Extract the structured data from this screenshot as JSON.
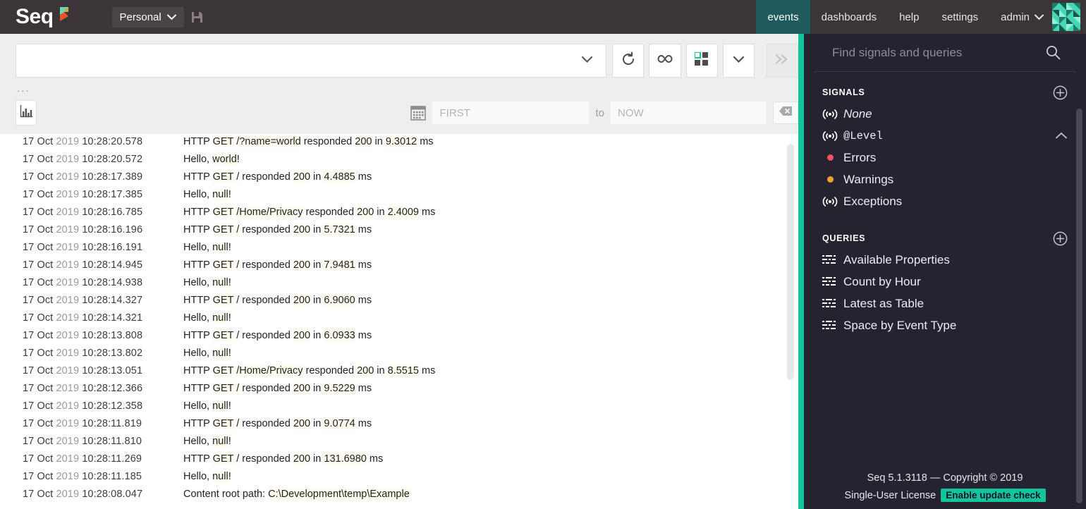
{
  "navbar": {
    "brand": "Seq",
    "brand_mark_icon": "seq-flag-logo",
    "personal_label": "Personal",
    "personal_chevron_icon": "chevron-down-icon",
    "save_icon": "save-disk-icon",
    "items": [
      {
        "label": "events",
        "active": true
      },
      {
        "label": "dashboards",
        "active": false
      },
      {
        "label": "help",
        "active": false
      },
      {
        "label": "settings",
        "active": false
      }
    ],
    "admin_label": "admin",
    "admin_chevron_icon": "chevron-down-icon",
    "avatar_icon": "user-identicon-avatar"
  },
  "toolbar": {
    "query_value": "",
    "query_placeholder": "",
    "query_chevron_icon": "chevron-down-icon",
    "refresh_icon": "refresh-icon",
    "tail_icon": "infinity-tail-icon",
    "grid_icon": "grid-columns-icon",
    "more_chevron_icon": "chevron-down-icon",
    "expand_icon": "double-chevron-right-icon",
    "ellipsis": "...",
    "chart_toggle_icon": "bar-chart-icon",
    "calendar_icon": "calendar-icon",
    "range_from_value": "",
    "range_from_placeholder": "FIRST",
    "range_to_label": "to",
    "range_to_value": "",
    "range_to_placeholder": "NOW",
    "clear_icon": "clear-backspace-icon"
  },
  "events": [
    {
      "date": "17 Oct ",
      "year": "2019",
      "time": "10:28:20.578",
      "parts": [
        {
          "t": "HTTP ",
          "h": false
        },
        {
          "t": "GET",
          "h": true
        },
        {
          "t": " ",
          "h": false
        },
        {
          "t": "/?name=world",
          "h": true
        },
        {
          "t": " responded ",
          "h": false
        },
        {
          "t": "200",
          "h": true
        },
        {
          "t": " in ",
          "h": false
        },
        {
          "t": "9.3012",
          "h": true
        },
        {
          "t": " ms",
          "h": false
        }
      ]
    },
    {
      "date": "17 Oct ",
      "year": "2019",
      "time": "10:28:20.572",
      "parts": [
        {
          "t": "Hello, ",
          "h": false
        },
        {
          "t": "world",
          "h": true
        },
        {
          "t": "!",
          "h": false
        }
      ]
    },
    {
      "date": "17 Oct ",
      "year": "2019",
      "time": "10:28:17.389",
      "parts": [
        {
          "t": "HTTP ",
          "h": false
        },
        {
          "t": "GET",
          "h": true
        },
        {
          "t": " ",
          "h": false
        },
        {
          "t": "/",
          "h": true
        },
        {
          "t": " responded ",
          "h": false
        },
        {
          "t": "200",
          "h": true
        },
        {
          "t": " in ",
          "h": false
        },
        {
          "t": "4.4885",
          "h": true
        },
        {
          "t": " ms",
          "h": false
        }
      ]
    },
    {
      "date": "17 Oct ",
      "year": "2019",
      "time": "10:28:17.385",
      "parts": [
        {
          "t": "Hello, ",
          "h": false
        },
        {
          "t": "null",
          "h": true
        },
        {
          "t": "!",
          "h": false
        }
      ]
    },
    {
      "date": "17 Oct ",
      "year": "2019",
      "time": "10:28:16.785",
      "parts": [
        {
          "t": "HTTP ",
          "h": false
        },
        {
          "t": "GET",
          "h": true
        },
        {
          "t": " ",
          "h": false
        },
        {
          "t": "/Home/Privacy",
          "h": true
        },
        {
          "t": " responded ",
          "h": false
        },
        {
          "t": "200",
          "h": true
        },
        {
          "t": " in ",
          "h": false
        },
        {
          "t": "2.4009",
          "h": true
        },
        {
          "t": " ms",
          "h": false
        }
      ]
    },
    {
      "date": "17 Oct ",
      "year": "2019",
      "time": "10:28:16.196",
      "parts": [
        {
          "t": "HTTP ",
          "h": false
        },
        {
          "t": "GET",
          "h": true
        },
        {
          "t": " ",
          "h": false
        },
        {
          "t": "/",
          "h": true
        },
        {
          "t": " responded ",
          "h": false
        },
        {
          "t": "200",
          "h": true
        },
        {
          "t": " in ",
          "h": false
        },
        {
          "t": "5.7321",
          "h": true
        },
        {
          "t": " ms",
          "h": false
        }
      ]
    },
    {
      "date": "17 Oct ",
      "year": "2019",
      "time": "10:28:16.191",
      "parts": [
        {
          "t": "Hello, ",
          "h": false
        },
        {
          "t": "null",
          "h": true
        },
        {
          "t": "!",
          "h": false
        }
      ]
    },
    {
      "date": "17 Oct ",
      "year": "2019",
      "time": "10:28:14.945",
      "parts": [
        {
          "t": "HTTP ",
          "h": false
        },
        {
          "t": "GET",
          "h": true
        },
        {
          "t": " ",
          "h": false
        },
        {
          "t": "/",
          "h": true
        },
        {
          "t": " responded ",
          "h": false
        },
        {
          "t": "200",
          "h": true
        },
        {
          "t": " in ",
          "h": false
        },
        {
          "t": "7.9481",
          "h": true
        },
        {
          "t": " ms",
          "h": false
        }
      ]
    },
    {
      "date": "17 Oct ",
      "year": "2019",
      "time": "10:28:14.938",
      "parts": [
        {
          "t": "Hello, ",
          "h": false
        },
        {
          "t": "null",
          "h": true
        },
        {
          "t": "!",
          "h": false
        }
      ]
    },
    {
      "date": "17 Oct ",
      "year": "2019",
      "time": "10:28:14.327",
      "parts": [
        {
          "t": "HTTP ",
          "h": false
        },
        {
          "t": "GET",
          "h": true
        },
        {
          "t": " ",
          "h": false
        },
        {
          "t": "/",
          "h": true
        },
        {
          "t": " responded ",
          "h": false
        },
        {
          "t": "200",
          "h": true
        },
        {
          "t": " in ",
          "h": false
        },
        {
          "t": "6.9060",
          "h": true
        },
        {
          "t": " ms",
          "h": false
        }
      ]
    },
    {
      "date": "17 Oct ",
      "year": "2019",
      "time": "10:28:14.321",
      "parts": [
        {
          "t": "Hello, ",
          "h": false
        },
        {
          "t": "null",
          "h": true
        },
        {
          "t": "!",
          "h": false
        }
      ]
    },
    {
      "date": "17 Oct ",
      "year": "2019",
      "time": "10:28:13.808",
      "parts": [
        {
          "t": "HTTP ",
          "h": false
        },
        {
          "t": "GET",
          "h": true
        },
        {
          "t": " ",
          "h": false
        },
        {
          "t": "/",
          "h": true
        },
        {
          "t": " responded ",
          "h": false
        },
        {
          "t": "200",
          "h": true
        },
        {
          "t": " in ",
          "h": false
        },
        {
          "t": "6.0933",
          "h": true
        },
        {
          "t": " ms",
          "h": false
        }
      ]
    },
    {
      "date": "17 Oct ",
      "year": "2019",
      "time": "10:28:13.802",
      "parts": [
        {
          "t": "Hello, ",
          "h": false
        },
        {
          "t": "null",
          "h": true
        },
        {
          "t": "!",
          "h": false
        }
      ]
    },
    {
      "date": "17 Oct ",
      "year": "2019",
      "time": "10:28:13.051",
      "parts": [
        {
          "t": "HTTP ",
          "h": false
        },
        {
          "t": "GET",
          "h": true
        },
        {
          "t": " ",
          "h": false
        },
        {
          "t": "/Home/Privacy",
          "h": true
        },
        {
          "t": " responded ",
          "h": false
        },
        {
          "t": "200",
          "h": true
        },
        {
          "t": " in ",
          "h": false
        },
        {
          "t": "8.5515",
          "h": true
        },
        {
          "t": " ms",
          "h": false
        }
      ]
    },
    {
      "date": "17 Oct ",
      "year": "2019",
      "time": "10:28:12.366",
      "parts": [
        {
          "t": "HTTP ",
          "h": false
        },
        {
          "t": "GET",
          "h": true
        },
        {
          "t": " ",
          "h": false
        },
        {
          "t": "/",
          "h": true
        },
        {
          "t": " responded ",
          "h": false
        },
        {
          "t": "200",
          "h": true
        },
        {
          "t": " in ",
          "h": false
        },
        {
          "t": "9.5229",
          "h": true
        },
        {
          "t": " ms",
          "h": false
        }
      ]
    },
    {
      "date": "17 Oct ",
      "year": "2019",
      "time": "10:28:12.358",
      "parts": [
        {
          "t": "Hello, ",
          "h": false
        },
        {
          "t": "null",
          "h": true
        },
        {
          "t": "!",
          "h": false
        }
      ]
    },
    {
      "date": "17 Oct ",
      "year": "2019",
      "time": "10:28:11.819",
      "parts": [
        {
          "t": "HTTP ",
          "h": false
        },
        {
          "t": "GET",
          "h": true
        },
        {
          "t": " ",
          "h": false
        },
        {
          "t": "/",
          "h": true
        },
        {
          "t": " responded ",
          "h": false
        },
        {
          "t": "200",
          "h": true
        },
        {
          "t": " in ",
          "h": false
        },
        {
          "t": "9.0774",
          "h": true
        },
        {
          "t": " ms",
          "h": false
        }
      ]
    },
    {
      "date": "17 Oct ",
      "year": "2019",
      "time": "10:28:11.810",
      "parts": [
        {
          "t": "Hello, ",
          "h": false
        },
        {
          "t": "null",
          "h": true
        },
        {
          "t": "!",
          "h": false
        }
      ]
    },
    {
      "date": "17 Oct ",
      "year": "2019",
      "time": "10:28:11.269",
      "parts": [
        {
          "t": "HTTP ",
          "h": false
        },
        {
          "t": "GET",
          "h": true
        },
        {
          "t": " ",
          "h": false
        },
        {
          "t": "/",
          "h": true
        },
        {
          "t": " responded ",
          "h": false
        },
        {
          "t": "200",
          "h": true
        },
        {
          "t": " in ",
          "h": false
        },
        {
          "t": "131.6980",
          "h": true
        },
        {
          "t": " ms",
          "h": false
        }
      ]
    },
    {
      "date": "17 Oct ",
      "year": "2019",
      "time": "10:28:11.185",
      "parts": [
        {
          "t": "Hello, ",
          "h": false
        },
        {
          "t": "null",
          "h": true
        },
        {
          "t": "!",
          "h": false
        }
      ]
    },
    {
      "date": "17 Oct ",
      "year": "2019",
      "time": "10:28:08.047",
      "parts": [
        {
          "t": "Content root path: ",
          "h": false
        },
        {
          "t": "C:\\Development\\temp\\Example",
          "h": true
        }
      ]
    }
  ],
  "sidebar": {
    "search_value": "",
    "search_placeholder": "Find signals and queries",
    "search_icon": "search-icon",
    "signals_heading": "SIGNALS",
    "signals_add_icon": "plus-circle-icon",
    "signals": [
      {
        "label": "None",
        "icon": "signal-broadcast-icon",
        "style": "italic",
        "expandable": false
      },
      {
        "label": "@Level",
        "icon": "signal-broadcast-icon",
        "style": "mono",
        "expandable": true,
        "caret_icon": "chevron-up-icon",
        "children": [
          {
            "label": "Errors",
            "color": "#f0516b"
          },
          {
            "label": "Warnings",
            "color": "#f0a030"
          }
        ]
      },
      {
        "label": "Exceptions",
        "icon": "signal-broadcast-icon",
        "style": "normal",
        "expandable": false
      }
    ],
    "queries_heading": "QUERIES",
    "queries_add_icon": "plus-circle-icon",
    "queries": [
      {
        "label": "Available Properties",
        "icon": "query-grid-icon"
      },
      {
        "label": "Count by Hour",
        "icon": "query-grid-icon"
      },
      {
        "label": "Latest as Table",
        "icon": "query-grid-icon"
      },
      {
        "label": "Space by Event Type",
        "icon": "query-grid-icon"
      }
    ],
    "footer": {
      "copyright": "Seq 5.1.3118 — Copyright © 2019",
      "license": "Single-User License",
      "update_badge": "Enable update check"
    }
  },
  "colors": {
    "navbar_bg": "#3b3438",
    "active_tab_bg": "#1f5b5c",
    "accent_teal": "#12c49c",
    "sidebar_bg": "#25232f",
    "highlight": "#fdfbed",
    "error_dot": "#f0516b",
    "warning_dot": "#f0a030"
  }
}
